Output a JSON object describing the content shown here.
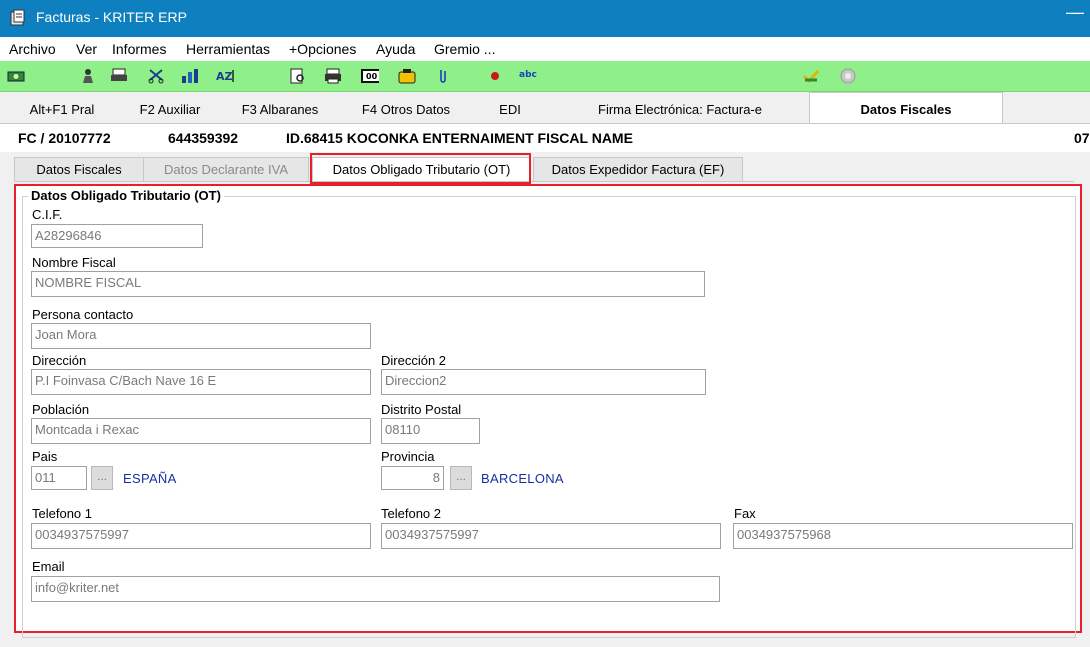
{
  "window": {
    "title": "Facturas - KRITER ERP"
  },
  "menu": [
    "Archivo",
    "Ver",
    "Informes",
    "Herramientas",
    "+Opciones",
    "Ayuda",
    "Gremio ..."
  ],
  "colors": {
    "titlebar": "#0e7fbf",
    "toolbar": "#8ff08a",
    "highlight": "#e8202a",
    "link": "#1a2fa0"
  },
  "toolbar_icons": [
    "money-icon",
    "user-icon",
    "print-icon",
    "scissors-icon",
    "chart-icon",
    "sort-icon",
    "preview-icon",
    "printer-icon",
    "counter-icon",
    "phone-icon",
    "attach-icon",
    "record-icon",
    "spellcheck-icon",
    "approve-icon",
    "refresh-icon"
  ],
  "top_tabs": [
    "Alt+F1 Pral",
    "F2 Auxiliar",
    "F3 Albaranes",
    "F4 Otros Datos",
    "EDI",
    "Firma Electrónica: Factura-e",
    "Datos Fiscales"
  ],
  "record": {
    "doc": "FC / 20107772",
    "number": "644359392",
    "name": "ID.68415 KOCONKA ENTERNAIMENT FISCAL NAME",
    "suffix": "07"
  },
  "sub_tabs": [
    "Datos Fiscales",
    "Datos Declarante IVA",
    "Datos Obligado Tributario (OT)",
    "Datos Expedidor Factura (EF)"
  ],
  "form": {
    "group_title": "Datos Obligado Tributario (OT)",
    "cif": {
      "label": "C.I.F.",
      "value": "A28296846"
    },
    "nombre_fiscal": {
      "label": "Nombre Fiscal",
      "value": "NOMBRE FISCAL"
    },
    "persona_contacto": {
      "label": "Persona contacto",
      "value": "Joan Mora"
    },
    "direccion": {
      "label": "Dirección",
      "value": "P.I Foinvasa C/Bach Nave 16 E"
    },
    "direccion2": {
      "label": "Dirección 2",
      "value": "Direccion2"
    },
    "poblacion": {
      "label": "Población",
      "value": "Montcada i Rexac"
    },
    "distrito_postal": {
      "label": "Distrito Postal",
      "value": "08110"
    },
    "pais": {
      "label": "Pais",
      "code": "011",
      "button": "...",
      "name": "ESPAÑA"
    },
    "provincia": {
      "label": "Provincia",
      "code": "8",
      "button": "...",
      "name": "BARCELONA"
    },
    "telefono1": {
      "label": "Telefono 1",
      "value": "0034937575997"
    },
    "telefono2": {
      "label": "Telefono 2",
      "value": "0034937575997"
    },
    "fax": {
      "label": "Fax",
      "value": "0034937575968"
    },
    "email": {
      "label": "Email",
      "value": "info@kriter.net"
    }
  }
}
